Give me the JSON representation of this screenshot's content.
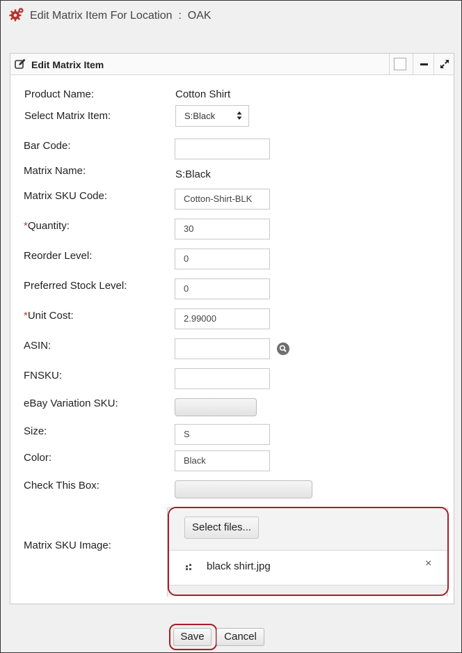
{
  "page": {
    "title": "Edit Matrix Item For Location",
    "separator": ":",
    "location": "OAK"
  },
  "panel": {
    "title": "Edit Matrix Item"
  },
  "form": {
    "product_name": {
      "label": "Product Name:",
      "value": "Cotton Shirt"
    },
    "select_matrix_item": {
      "label": "Select Matrix Item:",
      "value": "S:Black"
    },
    "bar_code": {
      "label": "Bar Code:",
      "value": ""
    },
    "matrix_name": {
      "label": "Matrix Name:",
      "value": "S:Black"
    },
    "matrix_sku_code": {
      "label": "Matrix SKU Code:",
      "value": "Cotton-Shirt-BLK"
    },
    "quantity": {
      "required_mark": "*",
      "label": "Quantity:",
      "value": "30"
    },
    "reorder_level": {
      "label": "Reorder Level:",
      "value": "0"
    },
    "preferred_stock_level": {
      "label": "Preferred Stock Level:",
      "value": "0"
    },
    "unit_cost": {
      "required_mark": "*",
      "label": "Unit Cost:",
      "value": "2.99000"
    },
    "asin": {
      "label": "ASIN:",
      "value": ""
    },
    "fnsku": {
      "label": "FNSKU:",
      "value": ""
    },
    "ebay_variation_sku": {
      "label": "eBay Variation SKU:"
    },
    "size": {
      "label": "Size:",
      "value": "S"
    },
    "color": {
      "label": "Color:",
      "value": "Black"
    },
    "check_this_box": {
      "label": "Check This Box:"
    },
    "matrix_sku_image": {
      "label": "Matrix SKU Image:",
      "select_files_label": "Select files...",
      "file_name": "black shirt.jpg",
      "remove_glyph": "×"
    }
  },
  "actions": {
    "save_label": "Save",
    "cancel_label": "Cancel"
  },
  "colors": {
    "highlight": "#a4202a",
    "required": "#c0392b",
    "icon_red": "#b5312c"
  },
  "icons": [
    "gears-icon",
    "edit-icon",
    "restore-square-icon",
    "minimize-icon",
    "expand-icon",
    "search-icon",
    "file-icon",
    "close-icon",
    "select-arrows-icon"
  ]
}
